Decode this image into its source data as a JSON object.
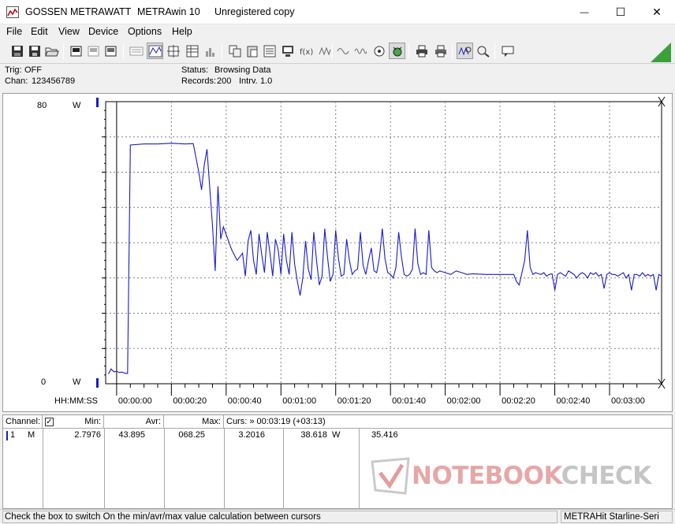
{
  "window": {
    "title_parts": [
      "GOSSEN METRAWATT",
      "METRAwin 10",
      "Unregistered copy"
    ],
    "controls": {
      "minimize": "—",
      "maximize": "☐",
      "close": "✕"
    }
  },
  "menu": [
    "File",
    "Edit",
    "View",
    "Device",
    "Options",
    "Help"
  ],
  "toolbar": {
    "buttons": [
      "save-icon",
      "save-as-icon",
      "open-folder-icon",
      "device-icon",
      "device-disabled-icon",
      "device-alt-icon",
      "keyboard-icon",
      "graph-view-icon",
      "crosshair-icon",
      "table-view-icon",
      "histogram-icon",
      "copy-icon",
      "paste-icon",
      "list-icon",
      "computer-icon",
      "function-icon",
      "waveform-icon",
      "wave-icon",
      "target-icon",
      "bug-icon",
      "printer-icon",
      "print-preview-icon",
      "zoom-waveform-icon",
      "zoom-icon",
      "chat-icon"
    ],
    "accent_color": "#3aa13a"
  },
  "info": {
    "trig_label": "Trig:",
    "trig_value": "OFF",
    "chan_label": "Chan:",
    "chan_value": "123456789",
    "status_label": "Status:",
    "status_value": "Browsing Data",
    "records_label": "Records:",
    "records_value": "200",
    "intrv_label": "Intrv.",
    "intrv_value": "1.0"
  },
  "chart": {
    "y_top_label": "80",
    "y_bottom_label": "0",
    "unit": "W",
    "x_axis_label": "HH:MM:SS",
    "line_color": "#1a1acc"
  },
  "chart_data": {
    "type": "line",
    "xlabel": "HH:MM:SS",
    "ylabel": "W",
    "ylim": [
      0,
      80
    ],
    "xlim_seconds": [
      -4,
      199
    ],
    "x_ticks": [
      "00:00:00",
      "00:00:20",
      "00:00:40",
      "00:01:00",
      "00:01:20",
      "00:01:40",
      "00:02:00",
      "00:02:20",
      "00:02:40",
      "00:03:00"
    ],
    "grid": true,
    "series": [
      {
        "values": [
          [
            -3,
            2.8
          ],
          [
            -2,
            4.2
          ],
          [
            -1,
            3.4
          ],
          [
            0,
            3.5
          ],
          [
            1,
            3.2
          ],
          [
            2,
            3.3
          ],
          [
            3,
            3.0
          ],
          [
            4,
            2.9
          ],
          [
            5,
            67.7
          ],
          [
            10,
            68.0
          ],
          [
            15,
            68.0
          ],
          [
            20,
            68.2
          ],
          [
            25,
            68.0
          ],
          [
            28,
            68.1
          ],
          [
            30,
            60.0
          ],
          [
            31,
            55.0
          ],
          [
            32,
            62.0
          ],
          [
            33,
            66.5
          ],
          [
            35,
            45.0
          ],
          [
            36,
            32.0
          ],
          [
            37,
            56.0
          ],
          [
            38,
            41.0
          ],
          [
            39,
            44.5
          ],
          [
            42,
            38.0
          ],
          [
            44,
            35.0
          ],
          [
            46,
            37.0
          ],
          [
            47,
            30.5
          ],
          [
            48,
            40.5
          ],
          [
            49,
            43.5
          ],
          [
            50,
            35.0
          ],
          [
            51,
            31.0
          ],
          [
            52,
            42.5
          ],
          [
            53,
            36.5
          ],
          [
            54,
            31.5
          ],
          [
            55,
            43.0
          ],
          [
            56,
            37.0
          ],
          [
            57,
            30.5
          ],
          [
            58,
            41.0
          ],
          [
            59,
            38.0
          ],
          [
            60,
            31.0
          ],
          [
            61,
            42.5
          ],
          [
            62,
            35.0
          ],
          [
            63,
            31.0
          ],
          [
            64,
            43.0
          ],
          [
            65,
            34.0
          ],
          [
            66,
            29.0
          ],
          [
            67,
            25.0
          ],
          [
            68,
            30.0
          ],
          [
            69,
            40.5
          ],
          [
            70,
            32.5
          ],
          [
            71,
            29.5
          ],
          [
            72,
            43.0
          ],
          [
            73,
            35.0
          ],
          [
            74,
            28.0
          ],
          [
            75,
            30.5
          ],
          [
            76,
            44.0
          ],
          [
            77,
            36.0
          ],
          [
            78,
            29.0
          ],
          [
            79,
            31.0
          ],
          [
            80,
            43.5
          ],
          [
            81,
            35.5
          ],
          [
            82,
            30.5
          ],
          [
            83,
            31.0
          ],
          [
            84,
            41.0
          ],
          [
            85,
            35.0
          ],
          [
            86,
            31.0
          ],
          [
            87,
            32.0
          ],
          [
            88,
            32.5
          ],
          [
            89,
            43.0
          ],
          [
            90,
            33.5
          ],
          [
            91,
            31.0
          ],
          [
            92,
            35.0
          ],
          [
            93,
            38.5
          ],
          [
            94,
            32.0
          ],
          [
            95,
            31.5
          ],
          [
            96,
            36.0
          ],
          [
            97,
            44.0
          ],
          [
            98,
            35.5
          ],
          [
            99,
            31.5
          ],
          [
            100,
            31.0
          ],
          [
            101,
            30.0
          ],
          [
            102,
            33.0
          ],
          [
            103,
            43.0
          ],
          [
            104,
            36.0
          ],
          [
            105,
            31.0
          ],
          [
            106,
            30.5
          ],
          [
            107,
            31.0
          ],
          [
            108,
            32.5
          ],
          [
            109,
            44.0
          ],
          [
            110,
            34.0
          ],
          [
            111,
            31.0
          ],
          [
            112,
            31.5
          ],
          [
            113,
            31.0
          ],
          [
            114,
            43.5
          ],
          [
            115,
            33.0
          ],
          [
            116,
            32.0
          ],
          [
            117,
            31.5
          ],
          [
            118,
            32.0
          ],
          [
            120,
            31.5
          ],
          [
            122,
            31.0
          ],
          [
            124,
            32.0
          ],
          [
            126,
            31.5
          ],
          [
            128,
            31.0
          ],
          [
            130,
            31.2
          ],
          [
            135,
            31.0
          ],
          [
            140,
            31.0
          ],
          [
            145,
            31.0
          ],
          [
            146,
            29.0
          ],
          [
            147,
            28.0
          ],
          [
            148,
            31.5
          ],
          [
            149,
            35.0
          ],
          [
            150,
            43.5
          ],
          [
            151,
            33.0
          ],
          [
            152,
            31.0
          ],
          [
            153,
            31.5
          ],
          [
            154,
            31.2
          ],
          [
            155,
            31.0
          ],
          [
            156,
            31.5
          ],
          [
            157,
            30.5
          ],
          [
            158,
            31.0
          ],
          [
            159,
            31.2
          ],
          [
            160,
            26.5
          ],
          [
            161,
            31.0
          ],
          [
            162,
            31.5
          ],
          [
            163,
            31.0
          ],
          [
            164,
            30.5
          ],
          [
            165,
            32.0
          ],
          [
            166,
            31.5
          ],
          [
            167,
            31.0
          ],
          [
            168,
            30.0
          ],
          [
            169,
            31.0
          ],
          [
            170,
            31.5
          ],
          [
            171,
            31.0
          ],
          [
            172,
            30.0
          ],
          [
            173,
            31.5
          ],
          [
            174,
            31.0
          ],
          [
            175,
            31.5
          ],
          [
            176,
            30.5
          ],
          [
            177,
            31.0
          ],
          [
            178,
            27.0
          ],
          [
            179,
            31.0
          ],
          [
            180,
            31.5
          ],
          [
            181,
            31.0
          ],
          [
            182,
            31.0
          ],
          [
            183,
            30.5
          ],
          [
            184,
            31.0
          ],
          [
            185,
            31.5
          ],
          [
            186,
            30.0
          ],
          [
            187,
            31.0
          ],
          [
            188,
            26.5
          ],
          [
            189,
            31.0
          ],
          [
            190,
            31.0
          ],
          [
            191,
            30.5
          ],
          [
            192,
            31.5
          ],
          [
            193,
            30.5
          ],
          [
            194,
            31.0
          ],
          [
            195,
            30.5
          ],
          [
            196,
            31.0
          ],
          [
            197,
            26.5
          ],
          [
            198,
            31.0
          ],
          [
            199,
            30.5
          ]
        ]
      }
    ]
  },
  "table": {
    "headers": {
      "channel": "Channel:",
      "min": "Min:",
      "avr": "Avr:",
      "max": "Max:",
      "curs": "Curs: » 00:03:19 (+03:13)"
    },
    "row": {
      "num": "1",
      "mode": "M",
      "min": "2.7976",
      "avr": "43.895",
      "max": "068.25",
      "curs_a": "3.2016",
      "curs_b": "38.618",
      "curs_unit": "W",
      "curs_c": "35.416"
    },
    "checkbox_checked": true
  },
  "status": {
    "left": "Check the box to switch On the min/avr/max value calculation between cursors",
    "right": "METRAHit Starline-Seri"
  },
  "watermark": {
    "text_a": "NOTEBOOK",
    "text_b": "CHECK"
  }
}
